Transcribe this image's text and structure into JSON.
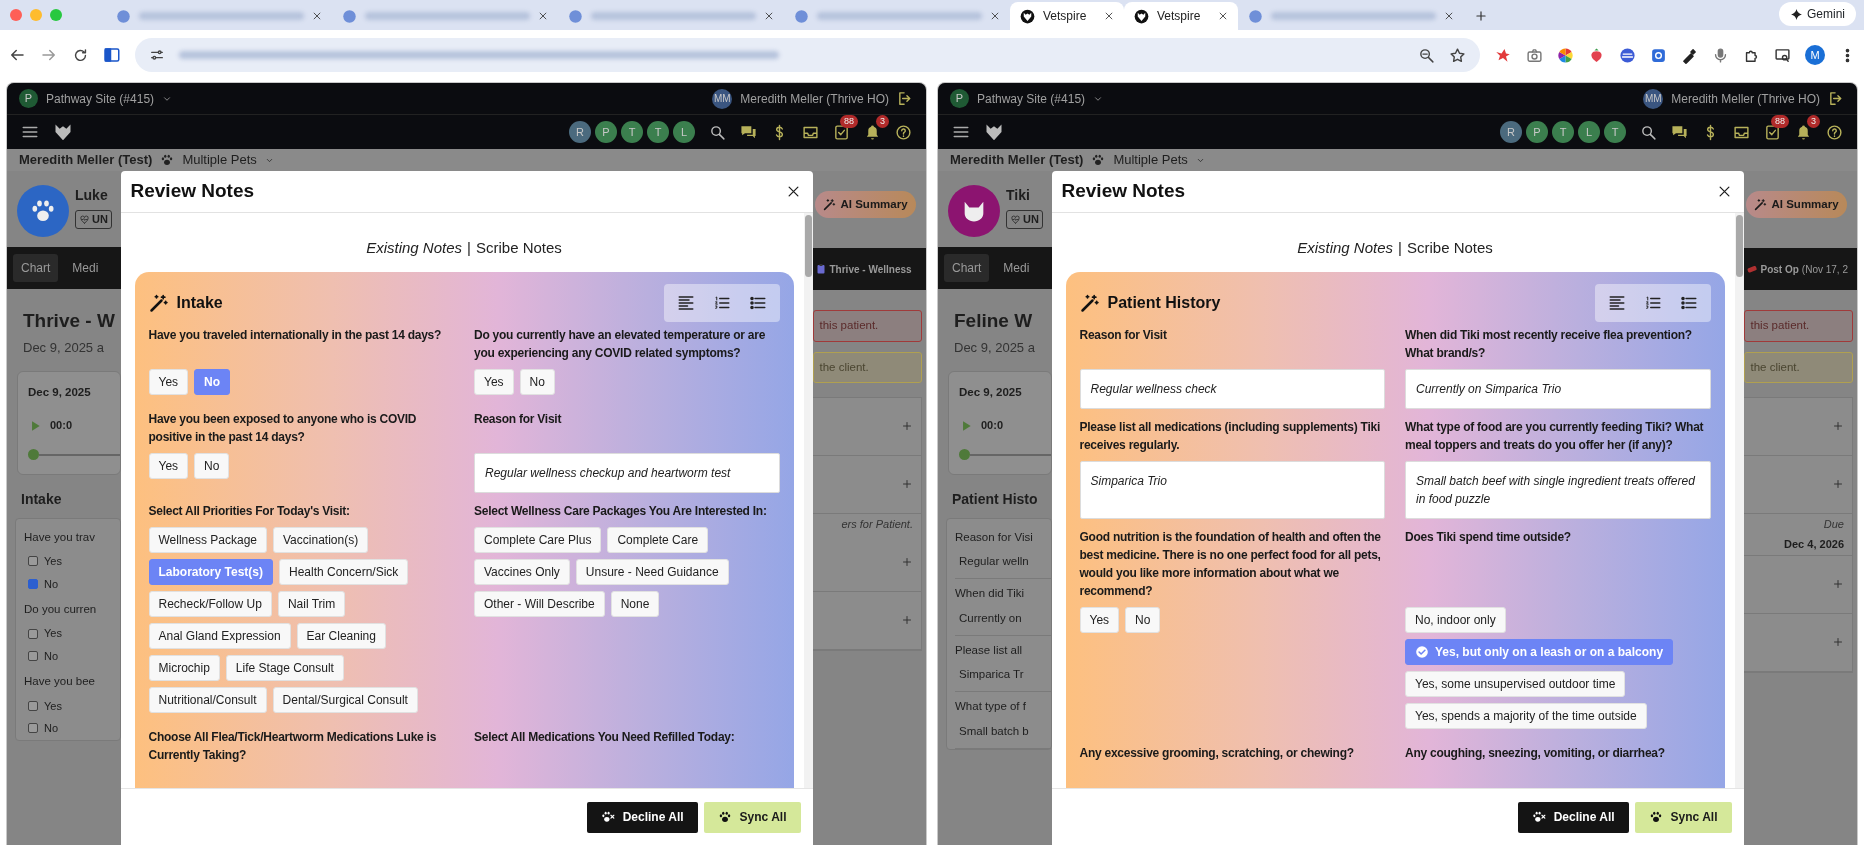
{
  "browser": {
    "tabs": [
      {
        "kind": "blurred",
        "selected": false
      },
      {
        "kind": "blurred",
        "selected": false
      },
      {
        "kind": "blurred",
        "selected": false
      },
      {
        "kind": "blurred",
        "selected": false
      },
      {
        "kind": "titled",
        "title": "Vetspire",
        "selected": true
      },
      {
        "kind": "titled",
        "title": "Vetspire",
        "selected": true
      },
      {
        "kind": "blurred",
        "selected": false
      }
    ],
    "assistant": "Gemini",
    "profile_initial": "M"
  },
  "panels": [
    {
      "site_initial": "P",
      "site": "Pathway Site (#415)",
      "user_initials": "MM",
      "user": "Meredith Meller (Thrive HO)",
      "staff": [
        {
          "initial": "R",
          "color": "#4b6a7e"
        },
        {
          "initial": "P",
          "color": "#3b7f4e"
        },
        {
          "initial": "T",
          "color": "#3b7f4e"
        },
        {
          "initial": "T",
          "color": "#3b7f4e"
        },
        {
          "initial": "L",
          "color": "#3b7f4e"
        }
      ],
      "tasks_badge": "88",
      "alerts_badge": "3",
      "client": "Meredith Meller (Test)",
      "pets": "Multiple Pets",
      "patient": {
        "name": "Luke",
        "kind": "dog",
        "color": "#2c66c4",
        "status": "UN"
      },
      "nav_tabs": [
        {
          "label": "Chart",
          "selected": true
        },
        {
          "label": "Medi",
          "selected": false
        }
      ],
      "title": "Thrive - W",
      "subtitle": "Dec 9, 2025 a",
      "recording": {
        "date": "Dec 9, 2025",
        "time": "00:0"
      },
      "section": "Intake",
      "side_list": [
        {
          "kind": "question",
          "text": "Have you trav"
        },
        {
          "kind": "check",
          "label": "Yes",
          "checked": false
        },
        {
          "kind": "check",
          "label": "No",
          "checked": true
        },
        {
          "kind": "question",
          "text": "Do you curren"
        },
        {
          "kind": "check",
          "label": "Yes",
          "checked": false
        },
        {
          "kind": "check",
          "label": "No",
          "checked": false
        },
        {
          "kind": "question",
          "text": "Have you bee"
        },
        {
          "kind": "check",
          "label": "Yes",
          "checked": false
        },
        {
          "kind": "check",
          "label": "No",
          "checked": false
        }
      ],
      "ai_button": "AI Summary",
      "encounter_tab": {
        "title": "Thrive - Wellness"
      },
      "notices": [
        {
          "kind": "danger",
          "text": "this patient."
        },
        {
          "kind": "warning",
          "text": "the client."
        }
      ],
      "side_rows": [
        {
          "kind": "plus"
        },
        {
          "kind": "plus"
        },
        {
          "kind": "note",
          "text": "ers for Patient."
        },
        {
          "kind": "plus"
        },
        {
          "kind": "plus"
        }
      ],
      "modal": {
        "title": "Review Notes",
        "tabs": [
          {
            "label": "Existing Notes",
            "selected": true
          },
          {
            "label": "Scribe Notes",
            "selected": false
          }
        ],
        "separator": "|",
        "section": "Intake",
        "rows": [
          [
            {
              "label": "Have you traveled internationally in the past 14 days?",
              "kind": "choice",
              "options": [
                {
                  "label": "Yes",
                  "selected": false
                },
                {
                  "label": "No",
                  "selected": true
                }
              ]
            },
            {
              "label": "Do you currently have an elevated temperature or are you experiencing any COVID related symptoms?",
              "kind": "choice",
              "options": [
                {
                  "label": "Yes",
                  "selected": false
                },
                {
                  "label": "No",
                  "selected": false
                }
              ]
            }
          ],
          [
            {
              "label": "Have you been exposed to anyone who is COVID positive in the past 14 days?",
              "kind": "choice",
              "options": [
                {
                  "label": "Yes",
                  "selected": false
                },
                {
                  "label": "No",
                  "selected": false
                }
              ]
            },
            {
              "label": "Reason for Visit",
              "kind": "text",
              "value": "Regular wellness checkup and heartworm test"
            }
          ],
          [
            {
              "label": "Select All Priorities For Today's Visit:",
              "kind": "choice",
              "options": [
                {
                  "label": "Wellness Package",
                  "selected": false
                },
                {
                  "label": "Vaccination(s)",
                  "selected": false
                },
                {
                  "label": "Laboratory Test(s)",
                  "selected": true
                },
                {
                  "label": "Health Concern/Sick",
                  "selected": false
                },
                {
                  "label": "Recheck/Follow Up",
                  "selected": false
                },
                {
                  "label": "Nail Trim",
                  "selected": false
                },
                {
                  "label": "Anal Gland Expression",
                  "selected": false
                },
                {
                  "label": "Ear Cleaning",
                  "selected": false
                },
                {
                  "label": "Microchip",
                  "selected": false
                },
                {
                  "label": "Life Stage Consult",
                  "selected": false
                },
                {
                  "label": "Nutritional/Consult",
                  "selected": false
                },
                {
                  "label": "Dental/Surgical Consult",
                  "selected": false
                }
              ]
            },
            {
              "label": "Select Wellness Care Packages You Are Interested In:",
              "kind": "choice",
              "options": [
                {
                  "label": "Complete Care Plus",
                  "selected": false
                },
                {
                  "label": "Complete Care",
                  "selected": false
                },
                {
                  "label": "Vaccines Only",
                  "selected": false
                },
                {
                  "label": "Unsure - Need Guidance",
                  "selected": false
                },
                {
                  "label": "Other - Will Describe",
                  "selected": false
                },
                {
                  "label": "None",
                  "selected": false
                }
              ]
            }
          ],
          [
            {
              "label": "Choose All Flea/Tick/Heartworm Medications Luke is Currently Taking?"
            },
            {
              "label": "Select All Medications You Need Refilled Today:"
            }
          ]
        ],
        "buttons": [
          {
            "kind": "decline",
            "label": "Decline All"
          },
          {
            "kind": "sync",
            "label": "Sync All"
          }
        ]
      }
    },
    {
      "site_initial": "P",
      "site": "Pathway Site (#415)",
      "user_initials": "MM",
      "user": "Meredith Meller (Thrive HO)",
      "staff": [
        {
          "initial": "R",
          "color": "#4b6a7e"
        },
        {
          "initial": "P",
          "color": "#3b7f4e"
        },
        {
          "initial": "T",
          "color": "#3b7f4e"
        },
        {
          "initial": "L",
          "color": "#3b7f4e"
        },
        {
          "initial": "T",
          "color": "#3b7f4e"
        }
      ],
      "tasks_badge": "88",
      "alerts_badge": "3",
      "client": "Meredith Meller (Test)",
      "pets": "Multiple Pets",
      "patient": {
        "name": "Tiki",
        "kind": "cat",
        "color": "#8c1470",
        "status": "UN"
      },
      "nav_tabs": [
        {
          "label": "Chart",
          "selected": true
        },
        {
          "label": "Medi",
          "selected": false
        }
      ],
      "title": "Feline W",
      "subtitle": "Dec 9, 2025 a",
      "recording": {
        "date": "Dec 9, 2025",
        "time": "00:0"
      },
      "section": "Patient Histo",
      "side_list": [
        {
          "kind": "question",
          "text": "Reason for Visi"
        },
        {
          "kind": "answer",
          "text": "Regular welln"
        },
        {
          "kind": "question",
          "text": "When did Tiki"
        },
        {
          "kind": "answer",
          "text": "Currently on"
        },
        {
          "kind": "question",
          "text": "Please list all"
        },
        {
          "kind": "answer",
          "text": "Simparica Tr"
        },
        {
          "kind": "question",
          "text": "What type of f"
        },
        {
          "kind": "answer",
          "text": "Small batch b"
        }
      ],
      "ai_button": "AI Summary",
      "encounter_tab": {
        "title": "Post Op",
        "detail": "(Nov 17, 2"
      },
      "notices": [
        {
          "kind": "danger",
          "text": "this patient."
        },
        {
          "kind": "warning",
          "text": "the client."
        }
      ],
      "side_rows": [
        {
          "kind": "plus"
        },
        {
          "kind": "plus"
        },
        {
          "kind": "note",
          "text": "Due"
        },
        {
          "kind": "date",
          "text": "Dec 4, 2026"
        },
        {
          "kind": "plus"
        },
        {
          "kind": "plus"
        }
      ],
      "modal": {
        "title": "Review Notes",
        "tabs": [
          {
            "label": "Existing Notes",
            "selected": true
          },
          {
            "label": "Scribe Notes",
            "selected": false
          }
        ],
        "separator": "|",
        "section": "Patient History",
        "rows": [
          [
            {
              "label": "Reason for Visit",
              "kind": "text",
              "value": "Regular wellness check"
            },
            {
              "label": "When did Tiki most recently receive flea prevention? What brand/s?",
              "kind": "text",
              "value": "Currently on Simparica Trio"
            }
          ],
          [
            {
              "label": "Please list all medications (including supplements) Tiki receives regularly.",
              "kind": "textarea",
              "value": "Simparica Trio"
            },
            {
              "label": "What type of food are you currently feeding Tiki? What meal toppers and treats do you offer her (if any)?",
              "kind": "textarea",
              "value": "Small batch beef with single ingredient treats offered in food puzzle"
            }
          ],
          [
            {
              "label": "Good nutrition is the foundation of health and often the best medicine. There is no one perfect food for all pets, would you like more information about what we recommend?",
              "kind": "choice",
              "options": [
                {
                  "label": "Yes",
                  "selected": false
                },
                {
                  "label": "No",
                  "selected": false
                }
              ]
            },
            {
              "label": "Does Tiki spend time outside?",
              "kind": "choice-list",
              "options": [
                {
                  "label": "No, indoor only",
                  "selected": false
                },
                {
                  "label": "Yes, but only on a leash or on a balcony",
                  "selected": true
                },
                {
                  "label": "Yes, some unsupervised outdoor time",
                  "selected": false
                },
                {
                  "label": "Yes, spends a majority of the time outside",
                  "selected": false
                }
              ]
            }
          ],
          [
            {
              "label": "Any excessive grooming, scratching, or chewing?"
            },
            {
              "label": "Any coughing, sneezing, vomiting, or diarrhea?"
            }
          ]
        ],
        "buttons": [
          {
            "kind": "decline",
            "label": "Decline All"
          },
          {
            "kind": "sync",
            "label": "Sync All"
          }
        ]
      }
    }
  ]
}
